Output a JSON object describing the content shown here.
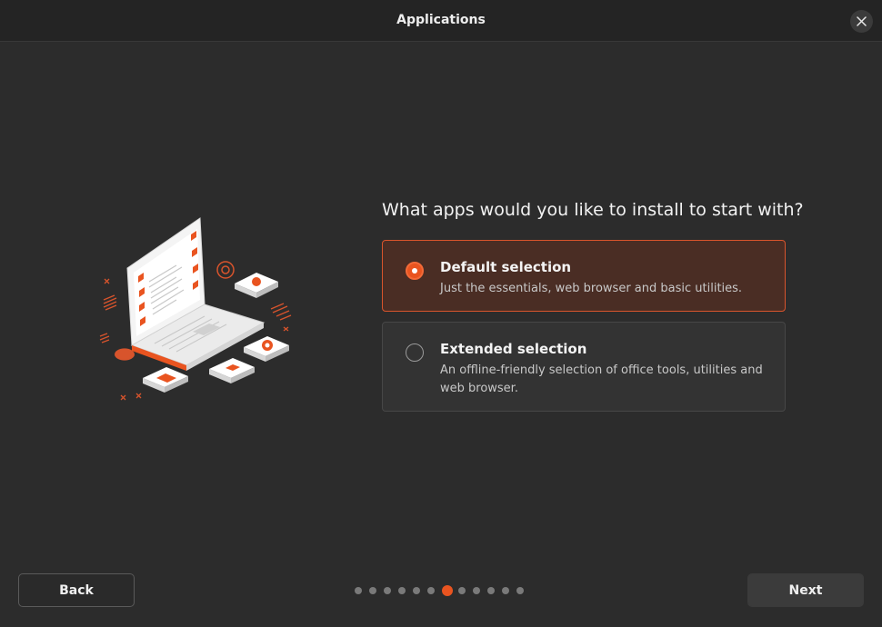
{
  "window": {
    "title": "Applications"
  },
  "question": "What apps would you like to install to start with?",
  "options": [
    {
      "title": "Default selection",
      "description": "Just the essentials, web browser and basic utilities.",
      "selected": true
    },
    {
      "title": "Extended selection",
      "description": "An offline-friendly selection of office tools, utilities and web browser.",
      "selected": false
    }
  ],
  "buttons": {
    "back": "Back",
    "next": "Next"
  },
  "progress": {
    "total_steps": 12,
    "current_step": 7
  },
  "colors": {
    "accent": "#e95420",
    "background": "#2c2c2c",
    "selected_bg": "#4a2d24"
  },
  "icons": {
    "close": "close-icon",
    "illustration": "laptop-apps-illustration"
  }
}
